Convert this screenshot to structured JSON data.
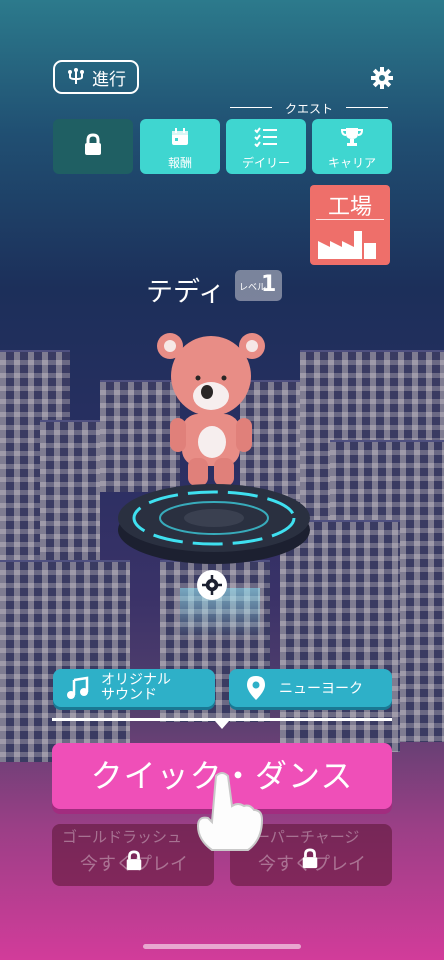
{
  "top": {
    "progress_label": "進行"
  },
  "quest": {
    "header": "クエスト",
    "buttons": [
      {
        "label": "",
        "icon": "lock-icon",
        "locked": true
      },
      {
        "label": "報酬",
        "icon": "calendar-icon"
      },
      {
        "label": "デイリー",
        "icon": "checklist-icon"
      },
      {
        "label": "キャリア",
        "icon": "trophy-icon"
      }
    ]
  },
  "factory": {
    "label": "工場",
    "icon": "factory-icon"
  },
  "character": {
    "name": "テディ",
    "level_prefix": "レベル",
    "level": "1"
  },
  "tags": {
    "music": "オリジナル\nサウンド",
    "city": "ニューヨーク"
  },
  "play": {
    "main_label": "クイック・ダンス"
  },
  "locked_modes": [
    {
      "title": "ゴールドラッシュ",
      "sub": "今すぐプレイ"
    },
    {
      "title": "スーパーチャージ",
      "sub": "今すぐプレイ"
    }
  ],
  "colors": {
    "accent": "#3fd6d0",
    "dance": "#ef4fb8",
    "factory": "#ee6f6a",
    "tag": "#2eb0c8"
  }
}
